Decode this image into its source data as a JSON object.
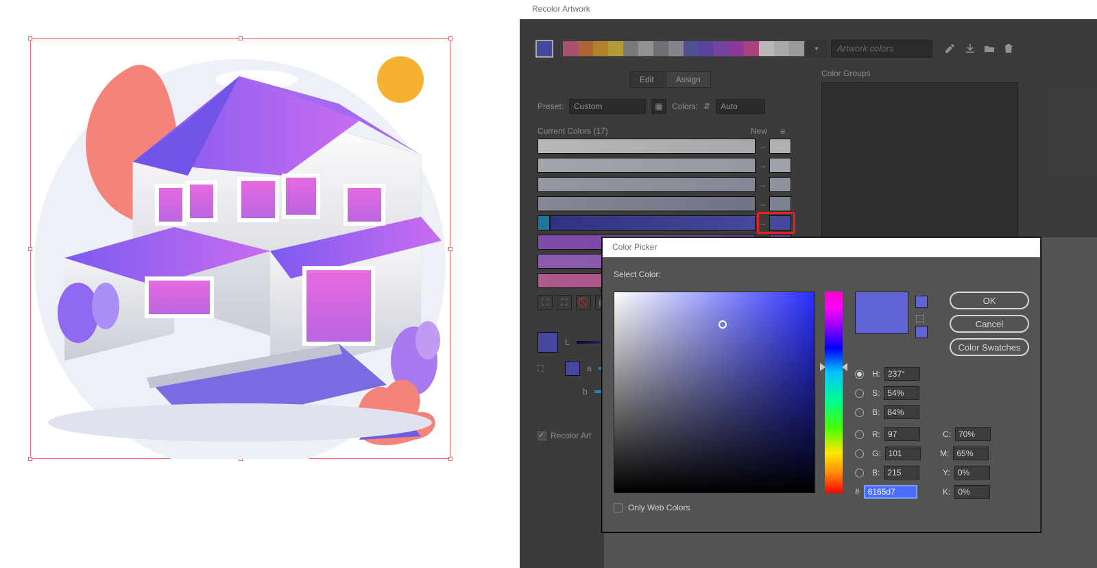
{
  "recolor": {
    "title": "Recolor Artwork",
    "tabs": {
      "edit": "Edit",
      "assign": "Assign"
    },
    "artwork_colors_placeholder": "Artwork colors",
    "preset_label": "Preset:",
    "preset_value": "Custom",
    "colors_label": "Colors:",
    "colors_value": "Auto",
    "current_colors_label": "Current Colors (17)",
    "new_label": "New",
    "color_groups_label": "Color Groups",
    "recolor_art_label": "Recolor Art",
    "swatch_strip": [
      "#ef6f9b",
      "#f28b4b",
      "#f4b43e",
      "#f6d84c",
      "#a9a9ad",
      "#c9cace",
      "#9a9aa2",
      "#b7b8c0",
      "#6e70cc",
      "#7f5ee0",
      "#a65ee0",
      "#c44fd2",
      "#ef5bb2",
      "#ffffff",
      "#e9e9ed",
      "#d6d6dc"
    ],
    "active_color": "#6165d7",
    "color_rows": [
      {
        "cur": "linear-gradient(90deg,#ffffff,#e9eaef)",
        "new": "#f4f5f8"
      },
      {
        "cur": "linear-gradient(90deg,#e2e5ee,#cfd3e0)",
        "new": "#dde1ec"
      },
      {
        "cur": "linear-gradient(90deg,#cfd3e0,#b8bdcf)",
        "new": "#c7ccdb"
      },
      {
        "cur": "linear-gradient(90deg,#b8bdcf,#9aa0b8)",
        "new": "#aeb4c8"
      },
      {
        "cur": "linear-gradient(90deg,#4246b5,#6165d7)",
        "new": "#6165d7",
        "highlight": true,
        "pre": "#2aa4d8"
      },
      {
        "cur": "linear-gradient(90deg,#b069ea,#a65ee0)",
        "new": "#a65ee0"
      },
      {
        "cur": "linear-gradient(90deg,#c37ef0,#b577e6)",
        "new": "#b577e6"
      },
      {
        "cur": "linear-gradient(90deg,#ef7fc2,#e06db0)",
        "new": "#e06db0"
      }
    ],
    "lab": {
      "L": "L",
      "a": "a",
      "b": "b"
    }
  },
  "picker": {
    "title": "Color Picker",
    "select_label": "Select Color:",
    "ok": "OK",
    "cancel": "Cancel",
    "swatches": "Color Swatches",
    "values": {
      "H": "237°",
      "S": "54%",
      "B": "84%",
      "R": "97",
      "G": "101",
      "Bch": "215",
      "C": "70%",
      "M": "65%",
      "Y": "0%",
      "K": "0%",
      "hex": "6165d7"
    },
    "labels": {
      "H": "H:",
      "S": "S:",
      "B": "B:",
      "R": "R:",
      "G": "G:",
      "Bch": "B:",
      "C": "C:",
      "M": "M:",
      "Y": "Y:",
      "K": "K:",
      "hash": "#"
    },
    "web_colors": "Only Web Colors",
    "preview_color": "#6165d7",
    "tiny_sw1": "#6165d7",
    "tiny_sw2": "#6165d7"
  }
}
